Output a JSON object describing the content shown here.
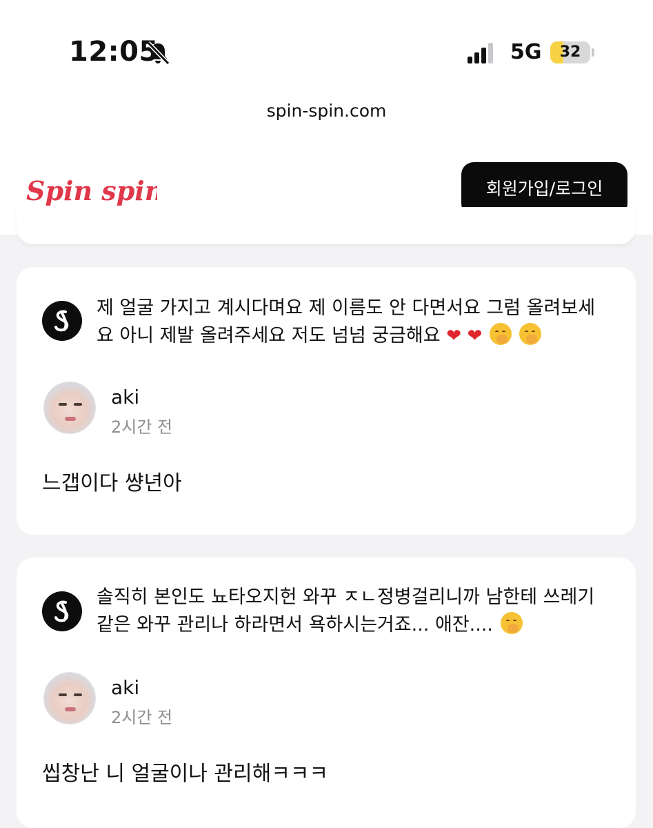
{
  "status_bar": {
    "time": "12:05",
    "network": "5G",
    "battery_percent": 32,
    "battery_label": "32",
    "mute_icon": "bell-slash-icon",
    "signal_icon": "cellular-signal-icon"
  },
  "browser": {
    "url": "spin-spin.com"
  },
  "header": {
    "logo_text": "Spin spin",
    "login_label": "회원가입/로그인"
  },
  "colors": {
    "brand_red": "#e0384a",
    "button_bg": "#0b0b0b",
    "page_bg": "#f3f3f5",
    "battery_yellow": "#f6d244"
  },
  "posts": [
    {
      "question_line1": "제 얼굴 가지고 계시다며요 제 이름도 안 다면서요 그럼 올려보세",
      "question_line2": "요 아니 제발 올려주세요 저도 넘넘 궁금해요",
      "question_emojis": [
        "❤️",
        "❤️",
        "🤭",
        "🤭"
      ],
      "username": "aki",
      "time_ago": "2시간 전",
      "answer": "느갭이다 썅년아"
    },
    {
      "question_line1": "솔직히 본인도 뇨타오지헌 와꾸 ㅈㄴ정병걸리니까 남한테 쓰레기",
      "question_line2": "같은 와꾸 관리나 하라면서 욕하시는거죠... 애잔....",
      "question_emojis": [
        "🤭"
      ],
      "username": "aki",
      "time_ago": "2시간 전",
      "answer": "씹창난 니 얼굴이나 관리해ㅋㅋㅋ"
    }
  ]
}
